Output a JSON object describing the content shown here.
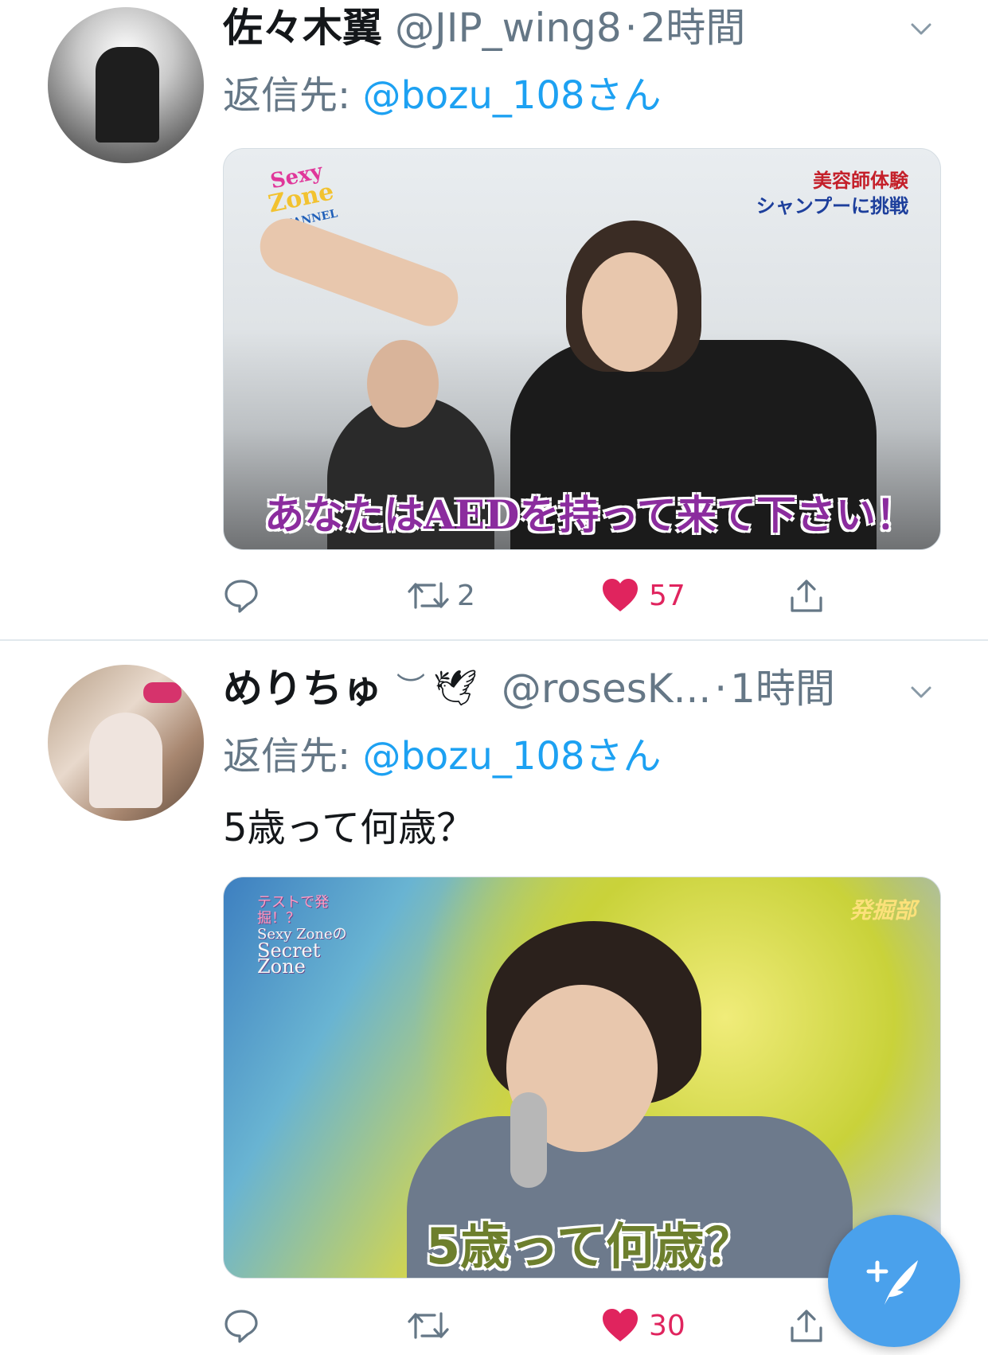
{
  "colors": {
    "link_blue": "#1da1f2",
    "secondary_text": "#657786",
    "like_red": "#e0245e",
    "fab_blue": "#4aa1ec"
  },
  "tweets": [
    {
      "display_name": "佐々木翼",
      "handle": "@JIP_wing8",
      "separator": "·",
      "time": "2時間",
      "reply_prefix": "返信先:",
      "reply_to": "@bozu_108さん",
      "text": "",
      "media": {
        "logo_lines": [
          "Sexy",
          "Zone",
          "CHANNEL"
        ],
        "corner_lines": [
          "美容師体験",
          "シャンプーに挑戦"
        ],
        "caption": "あなたはAEDを持って来て下さい！"
      },
      "actions": {
        "reply_icon": "reply-icon",
        "retweet_icon": "retweet-icon",
        "retweets": "2",
        "like_icon": "heart-icon",
        "likes": "57",
        "share_icon": "share-icon"
      }
    },
    {
      "display_name": "めりちゅ",
      "decoration": "︶",
      "dove": "🕊",
      "handle": "@rosesK...",
      "separator": "·",
      "time": "1時間",
      "reply_prefix": "返信先:",
      "reply_to": "@bozu_108さん",
      "text": "5歳って何歳？",
      "media": {
        "logo_lines": [
          "テストで発掘！？",
          "Sexy Zoneの",
          "Secret Zone"
        ],
        "corner_text": "発掘部",
        "caption": "5歳って何歳？"
      },
      "actions": {
        "reply_icon": "reply-icon",
        "retweet_icon": "retweet-icon",
        "retweets": "",
        "like_icon": "heart-icon",
        "likes": "30",
        "share_icon": "share-icon"
      }
    }
  ],
  "fab": {
    "icon": "compose-icon"
  }
}
